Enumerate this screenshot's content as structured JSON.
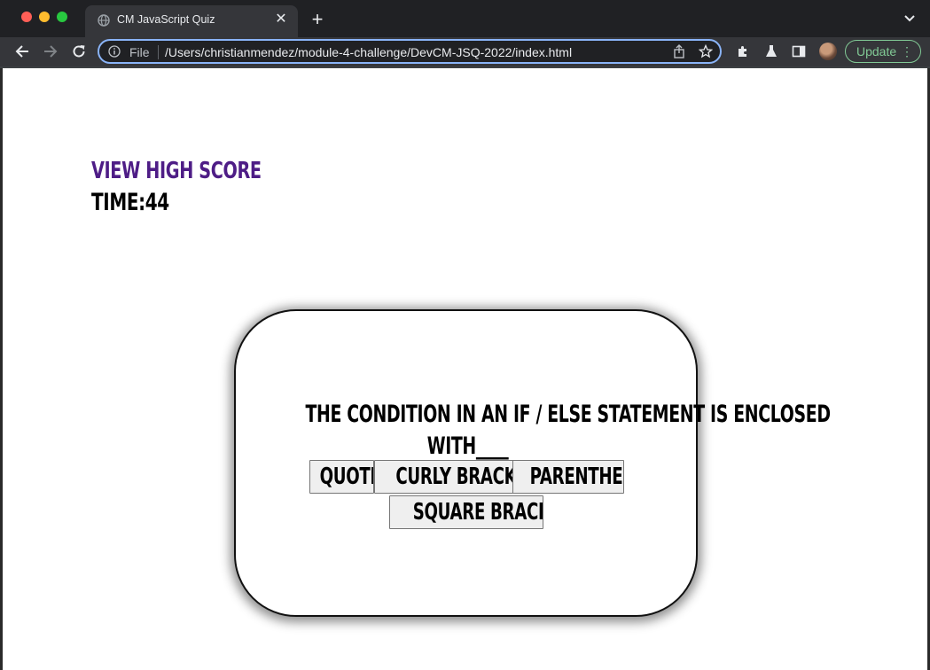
{
  "browser": {
    "tab_title": "CM JavaScript Quiz",
    "new_tab_symbol": "+",
    "close_symbol": "✕",
    "file_label": "File",
    "url": "/Users/christianmendez/module-4-challenge/DevCM-JSQ-2022/index.html",
    "update_label": "Update",
    "update_menu_symbol": "⋮",
    "icons": [
      "globe-icon",
      "close-icon",
      "plus-icon",
      "chevron-down-icon",
      "back-arrow-icon",
      "forward-arrow-icon",
      "reload-icon",
      "info-icon",
      "share-icon",
      "star-icon",
      "extensions-icon",
      "labs-flask-icon",
      "side-panel-icon",
      "avatar"
    ]
  },
  "page": {
    "high_score_link": "View High Score",
    "time_label": "Time:",
    "time_value": "44",
    "question_lines": [
      "The condition in an if / else statement is enclosed",
      "with____"
    ],
    "answers": [
      "quotes",
      "curly brackets",
      "parenthesis",
      "square brackets"
    ],
    "colors": {
      "high_score_link": "#4e1d86",
      "card_border": "#111111",
      "answer_bg": "#efefef",
      "omnibox_focus": "#8ab4f8",
      "update_green": "#81c995"
    }
  }
}
